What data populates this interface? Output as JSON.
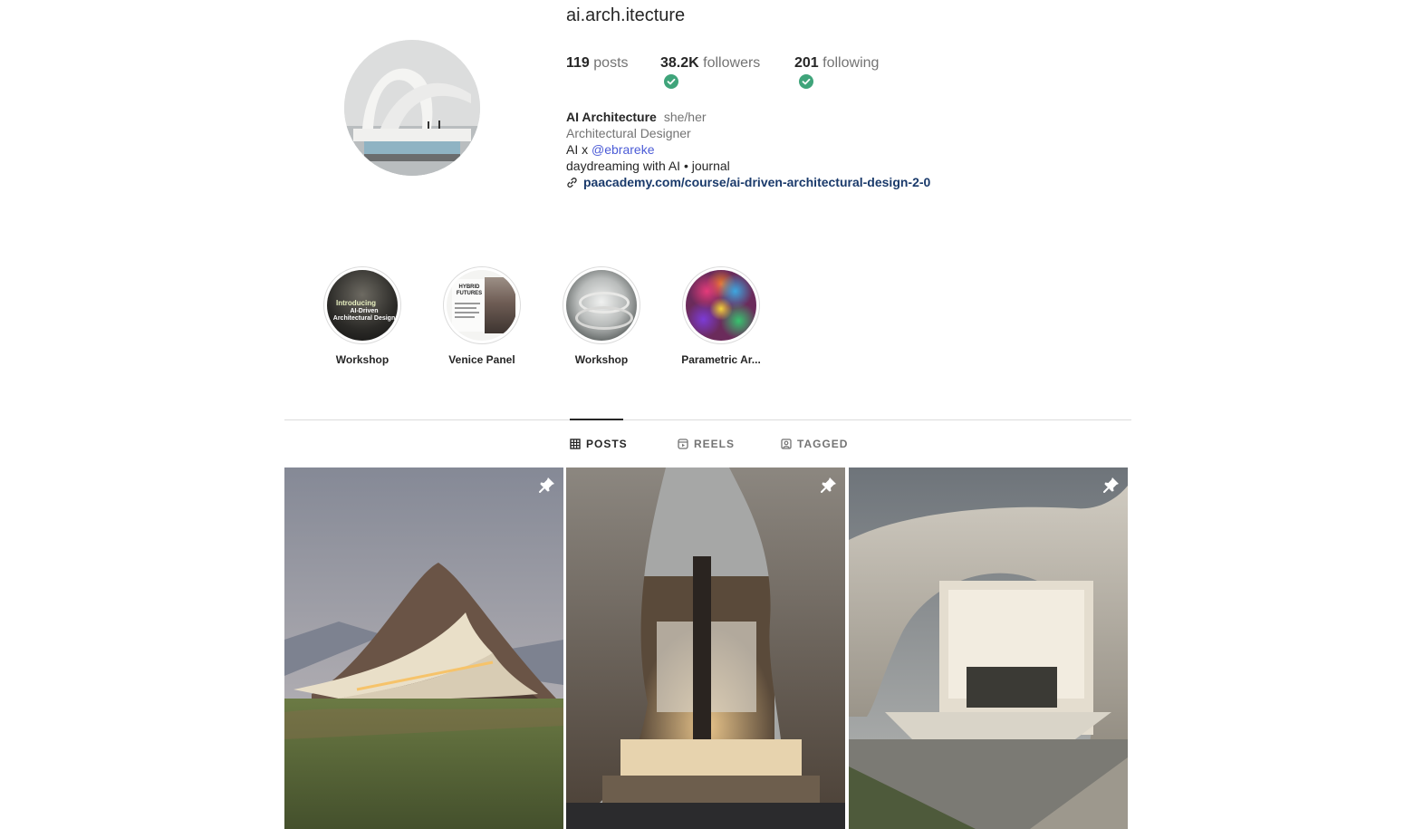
{
  "profile": {
    "username": "ai.arch.itecture",
    "stats": {
      "posts_count": "119",
      "posts_label": "posts",
      "followers_count": "38.2K",
      "followers_label": "followers",
      "following_count": "201",
      "following_label": "following"
    },
    "bio": {
      "name": "AI Architecture",
      "pronouns": "she/her",
      "category": "Architectural Designer",
      "line1_prefix": "AI x ",
      "line1_mention": "@ebrareke",
      "line2": "daydreaming with AI • journal",
      "link": "paacademy.com/course/ai-driven-architectural-design-2-0"
    }
  },
  "highlights": [
    {
      "label": "Workshop",
      "cover_text_1": "Introducing",
      "cover_text_2": "AI-Driven Architectural Design"
    },
    {
      "label": "Venice Panel",
      "cover_text_1": "HYBRID FUTURES"
    },
    {
      "label": "Workshop"
    },
    {
      "label": "Parametric Ar..."
    }
  ],
  "tabs": [
    {
      "label": "POSTS",
      "icon": "grid-icon",
      "active": true
    },
    {
      "label": "REELS",
      "icon": "reels-icon",
      "active": false
    },
    {
      "label": "TAGGED",
      "icon": "tagged-icon",
      "active": false
    }
  ],
  "posts": [
    {
      "pinned": true,
      "icon": "pin-icon"
    },
    {
      "pinned": true,
      "icon": "pin-icon"
    },
    {
      "pinned": true,
      "icon": "pin-icon"
    }
  ],
  "colors": {
    "verified_check": "#3fa47a",
    "mention": "#4b5bd6",
    "link": "#1a3a6b",
    "muted_text": "#737373"
  }
}
